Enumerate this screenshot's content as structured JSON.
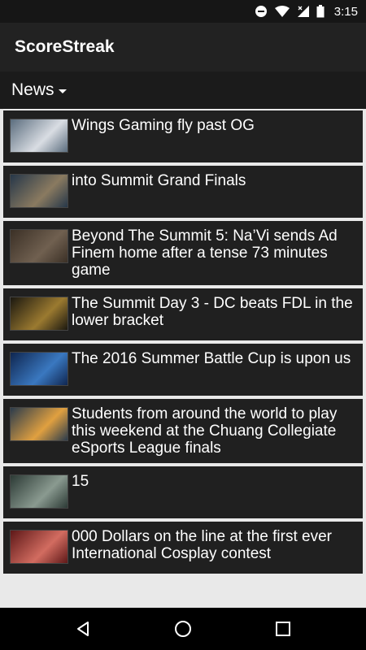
{
  "status_bar": {
    "time": "3:15",
    "icons": [
      "do-not-disturb-icon",
      "wifi-icon",
      "cell-signal-icon",
      "battery-icon"
    ]
  },
  "app_bar": {
    "title": "ScoreStreak"
  },
  "section": {
    "label": "News",
    "icon": "chevron-down-icon"
  },
  "news": [
    {
      "headline": "Wings Gaming fly past OG",
      "thumb_colors": [
        "#5b6d7e",
        "#d9dde3"
      ]
    },
    {
      "headline": "into Summit Grand Finals",
      "thumb_colors": [
        "#263749",
        "#8a7a60"
      ]
    },
    {
      "headline": "Beyond The Summit 5: Na’Vi sends Ad Finem home after a tense 73 minutes game",
      "thumb_colors": [
        "#3b3026",
        "#706050"
      ]
    },
    {
      "headline": "The Summit Day 3 - DC beats FDL in the lower bracket",
      "thumb_colors": [
        "#1b1810",
        "#9b7a30"
      ]
    },
    {
      "headline": "The 2016 Summer Battle Cup is upon us",
      "thumb_colors": [
        "#0f2650",
        "#3a78c0"
      ]
    },
    {
      "headline": "Students from around the world to play this weekend at the Chuang Collegiate eSports League finals",
      "thumb_colors": [
        "#2a3b4c",
        "#e0a040"
      ]
    },
    {
      "headline": "15",
      "thumb_colors": [
        "#2c3a35",
        "#8a9a90"
      ]
    },
    {
      "headline": "000 Dollars on the line at the first ever International Cosplay contest",
      "thumb_colors": [
        "#5e1818",
        "#d26c60"
      ]
    }
  ],
  "nav_bar": {
    "icons": [
      "back-icon",
      "home-icon",
      "recents-icon"
    ]
  }
}
